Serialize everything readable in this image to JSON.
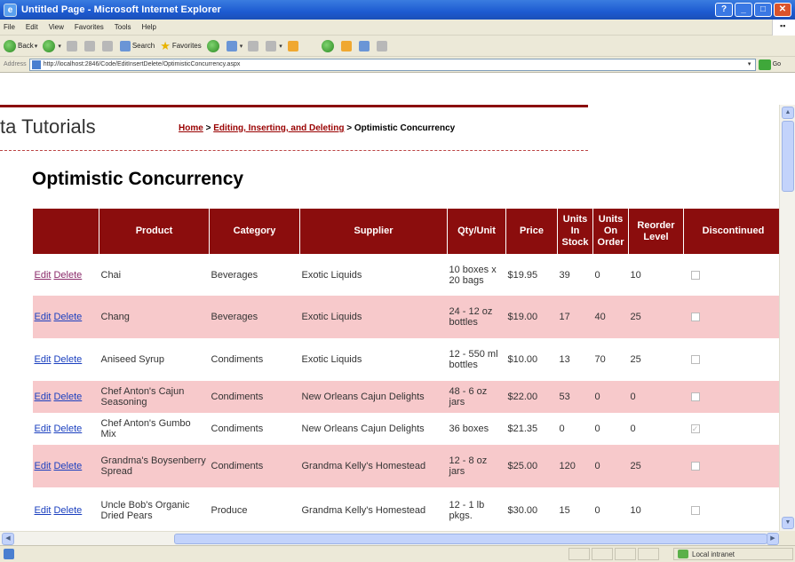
{
  "window": {
    "title": "Untitled Page - Microsoft Internet Explorer",
    "buttons": [
      "help",
      "minimize",
      "maximize",
      "close"
    ]
  },
  "menu": [
    "File",
    "Edit",
    "View",
    "Favorites",
    "Tools",
    "Help"
  ],
  "toolbar": {
    "back_label": "Back",
    "search_label": "Search",
    "favorites_label": "Favorites"
  },
  "address": {
    "label": "Address",
    "url": "http://localhost:2846/Code/EditInsertDelete/OptimisticConcurrency.aspx",
    "go_label": "Go"
  },
  "page": {
    "brand": "ta Tutorials",
    "breadcrumb": {
      "home": "Home",
      "sep1": " > ",
      "section": "Editing, Inserting, and Deleting",
      "sep2": " > ",
      "current": "Optimistic Concurrency"
    },
    "title": "Optimistic Concurrency"
  },
  "grid": {
    "headers": {
      "command": "",
      "product": "Product",
      "category": "Category",
      "supplier": "Supplier",
      "qty": "Qty/Unit",
      "price": "Price",
      "instock": "Units In Stock",
      "onorder": "Units On Order",
      "reorder": "Reorder Level",
      "discontinued": "Discontinued"
    },
    "edit_label": "Edit",
    "delete_label": "Delete",
    "rows": [
      {
        "product": "Chai",
        "category": "Beverages",
        "supplier": "Exotic Liquids",
        "qty": "10 boxes x 20 bags",
        "price": "$19.95",
        "instock": "39",
        "onorder": "0",
        "reorder": "10",
        "discontinued": false
      },
      {
        "product": "Chang",
        "category": "Beverages",
        "supplier": "Exotic Liquids",
        "qty": "24 - 12 oz bottles",
        "price": "$19.00",
        "instock": "17",
        "onorder": "40",
        "reorder": "25",
        "discontinued": false
      },
      {
        "product": "Aniseed Syrup",
        "category": "Condiments",
        "supplier": "Exotic Liquids",
        "qty": "12 - 550 ml bottles",
        "price": "$10.00",
        "instock": "13",
        "onorder": "70",
        "reorder": "25",
        "discontinued": false
      },
      {
        "product": "Chef Anton's Cajun Seasoning",
        "category": "Condiments",
        "supplier": "New Orleans Cajun Delights",
        "qty": "48 - 6 oz jars",
        "price": "$22.00",
        "instock": "53",
        "onorder": "0",
        "reorder": "0",
        "discontinued": false
      },
      {
        "product": "Chef Anton's Gumbo Mix",
        "category": "Condiments",
        "supplier": "New Orleans Cajun Delights",
        "qty": "36 boxes",
        "price": "$21.35",
        "instock": "0",
        "onorder": "0",
        "reorder": "0",
        "discontinued": true
      },
      {
        "product": "Grandma's Boysenberry Spread",
        "category": "Condiments",
        "supplier": "Grandma Kelly's Homestead",
        "qty": "12 - 8 oz jars",
        "price": "$25.00",
        "instock": "120",
        "onorder": "0",
        "reorder": "25",
        "discontinued": false
      },
      {
        "product": "Uncle Bob's Organic Dried Pears",
        "category": "Produce",
        "supplier": "Grandma Kelly's Homestead",
        "qty": "12 - 1 lb pkgs.",
        "price": "$30.00",
        "instock": "15",
        "onorder": "0",
        "reorder": "10",
        "discontinued": false
      }
    ]
  },
  "status": {
    "zone": "Local intranet"
  }
}
